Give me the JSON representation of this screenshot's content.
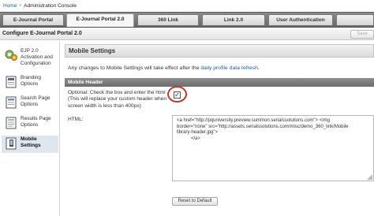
{
  "breadcrumb": {
    "home": "Home",
    "separator": "»",
    "current": "Administration Console"
  },
  "tabs": [
    {
      "label": "E-Journal Portal",
      "active": false
    },
    {
      "label": "E-Journal Portal 2.0",
      "active": true
    },
    {
      "label": "360 Link",
      "active": false
    },
    {
      "label": "Link 2.0",
      "active": false
    },
    {
      "label": "User Authentication",
      "active": false
    },
    {
      "label": "",
      "active": false
    }
  ],
  "config": {
    "title": "Configure E-Journal Portal 2.0",
    "action_button_label": "Save"
  },
  "sidebar": {
    "items": [
      {
        "label": "EJP 2.0 Activation and Configuration",
        "icon": "gear-icon",
        "active": false
      },
      {
        "label": "Branding Options",
        "icon": "branding-document-icon",
        "active": false
      },
      {
        "label": "Search Page Options",
        "icon": "search-page-icon",
        "active": false
      },
      {
        "label": "Results Page Options",
        "icon": "results-page-icon",
        "active": false
      },
      {
        "label": "Mobile Settings",
        "icon": "mobile-device-icon",
        "active": true
      }
    ]
  },
  "main": {
    "section_title": "Mobile Settings",
    "notice_text": "Any changes to Mobile Settings will take effect after the",
    "notice_link": "daily profile data refresh",
    "notice_end": ".",
    "subheader": "Mobile Header",
    "optional_label": "Optional: Check the box and enter the html (This will replace your custom header when screen width is less than 400px):",
    "checkbox_checked": true,
    "checkbox_mark": "✓",
    "html_label": "HTML:",
    "html_lines": [
      "<a href=\"http://pquniversity.preview.summon.serialssolutions.com\"> <img",
      "border=\"none\" src=\"http://assets.serialssolutions.com/misc/demo_360_link/Mobile",
      "library-header.jpg\">",
      "</a>"
    ],
    "reset_button": "Reset to Default"
  },
  "colors": {
    "tab_bar": "#7a7a7a",
    "subheader_bg": "#7d7d7d",
    "highlight_ring": "#c0392b",
    "link": "#1a5a9a",
    "sidebar_active": "#dfe6ee"
  }
}
